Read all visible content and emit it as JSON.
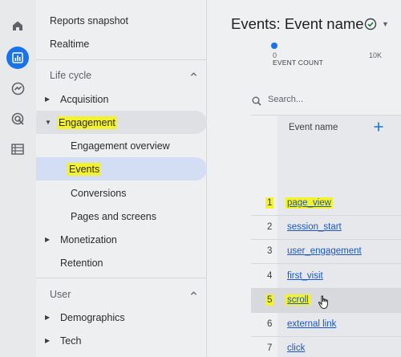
{
  "rail": {
    "icons": [
      "home-icon",
      "reports-icon",
      "explore-icon",
      "advertising-icon",
      "configure-icon"
    ],
    "active_icon": "reports-icon",
    "accent": "#1a73e8"
  },
  "nav": {
    "reports_snapshot": "Reports snapshot",
    "realtime": "Realtime",
    "lifecycle": {
      "header": "Life cycle",
      "acquisition": "Acquisition",
      "engagement": "Engagement",
      "engagement_overview": "Engagement overview",
      "events": "Events",
      "conversions": "Conversions",
      "pages_and_screens": "Pages and screens",
      "monetization": "Monetization",
      "retention": "Retention"
    },
    "user": {
      "header": "User",
      "demographics": "Demographics",
      "tech": "Tech"
    },
    "highlight_color": "#f4f22d",
    "selected_color": "#d3def4"
  },
  "main": {
    "title": "Events: Event name",
    "chart": {
      "tick_0": "0",
      "tick_10k": "10K",
      "axis_title": "EVENT COUNT"
    },
    "search_placeholder": "Search...",
    "column_header": "Event name",
    "rows": [
      {
        "index": "1",
        "name": "page_view"
      },
      {
        "index": "2",
        "name": "session_start"
      },
      {
        "index": "3",
        "name": "user_engagement"
      },
      {
        "index": "4",
        "name": "first_visit"
      },
      {
        "index": "5",
        "name": "scroll"
      },
      {
        "index": "6",
        "name": "external link"
      },
      {
        "index": "7",
        "name": "click"
      }
    ],
    "link_color": "#1a56c4"
  }
}
